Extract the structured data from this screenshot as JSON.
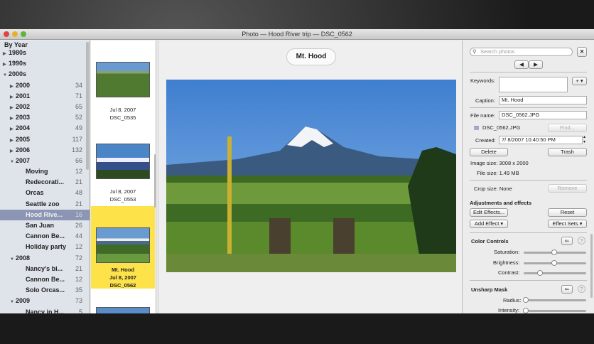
{
  "window": {
    "title": "Photo — Hood River trip — DSC_0562"
  },
  "sidebar": {
    "header": "By Year",
    "items": [
      {
        "label": "1980s",
        "count": "",
        "level": 0,
        "state": "collapsed"
      },
      {
        "label": "1990s",
        "count": "",
        "level": 0,
        "state": "collapsed"
      },
      {
        "label": "2000s",
        "count": "",
        "level": 0,
        "state": "expanded"
      },
      {
        "label": "2000",
        "count": "34",
        "level": 1,
        "state": "collapsed"
      },
      {
        "label": "2001",
        "count": "71",
        "level": 1,
        "state": "collapsed"
      },
      {
        "label": "2002",
        "count": "65",
        "level": 1,
        "state": "collapsed"
      },
      {
        "label": "2003",
        "count": "52",
        "level": 1,
        "state": "collapsed"
      },
      {
        "label": "2004",
        "count": "49",
        "level": 1,
        "state": "collapsed"
      },
      {
        "label": "2005",
        "count": "117",
        "level": 1,
        "state": "collapsed"
      },
      {
        "label": "2006",
        "count": "132",
        "level": 1,
        "state": "collapsed"
      },
      {
        "label": "2007",
        "count": "66",
        "level": 1,
        "state": "expanded"
      },
      {
        "label": "Moving",
        "count": "12",
        "level": 2
      },
      {
        "label": "Redecorati...",
        "count": "21",
        "level": 2
      },
      {
        "label": "Orcas",
        "count": "48",
        "level": 2
      },
      {
        "label": "Seattle zoo",
        "count": "21",
        "level": 2
      },
      {
        "label": "Hood Rive...",
        "count": "16",
        "level": 2,
        "selected": true
      },
      {
        "label": "San Juan",
        "count": "26",
        "level": 2
      },
      {
        "label": "Cannon Be...",
        "count": "44",
        "level": 2
      },
      {
        "label": "Holiday party",
        "count": "12",
        "level": 2
      },
      {
        "label": "2008",
        "count": "72",
        "level": 1,
        "state": "expanded"
      },
      {
        "label": "Nancy's bi...",
        "count": "21",
        "level": 2
      },
      {
        "label": "Cannon Be...",
        "count": "12",
        "level": 2
      },
      {
        "label": "Solo Orcas...",
        "count": "35",
        "level": 2
      },
      {
        "label": "2009",
        "count": "73",
        "level": 1,
        "state": "expanded"
      },
      {
        "label": "Nancy in H...",
        "count": "5",
        "level": 2
      }
    ]
  },
  "thumbnails": [
    {
      "caption": "",
      "date": "Jul 8, 2007",
      "name": "DSC_0535"
    },
    {
      "caption": "",
      "date": "Jul 8, 2007",
      "name": "DSC_0553"
    },
    {
      "caption": "Mt. Hood",
      "date": "Jul 8, 2007",
      "name": "DSC_0562",
      "selected": true
    }
  ],
  "main": {
    "caption": "Mt. Hood"
  },
  "inspector": {
    "search_placeholder": "Search photos",
    "keywords_label": "Keywords:",
    "keywords_value": "",
    "keywords_add": "+ ▾",
    "caption_label": "Caption:",
    "caption_value": "Mt. Hood",
    "filename_label": "File name:",
    "filename_value": "DSC_0562.JPG",
    "file_ref": "DSC_0562.JPG",
    "find": "Find...",
    "created_label": "Created:",
    "created_value": "7/  8/2007  10:40:50  PM",
    "delete": "Delete",
    "trash": "Trash",
    "image_size": "Image size: 3008 x 2000",
    "file_size": "File size:  1.49 MB",
    "crop_size": "Crop size:  None",
    "remove": "Remove",
    "adjustments_title": "Adjustments and effects",
    "edit_effects": "Edit Effects...",
    "reset": "Reset",
    "add_effect": "Add Effect  ▾",
    "effect_sets": "Effect Sets  ▾",
    "color_controls": "Color Controls",
    "saturation_label": "Saturation:",
    "saturation": 0.5,
    "brightness_label": "Brightness:",
    "brightness": 0.5,
    "contrast_label": "Contrast:",
    "contrast": 0.25,
    "unsharp_mask": "Unsharp Mask",
    "radius_label": "Radius:",
    "radius": 0.0,
    "intensity_label": "Intensity:",
    "intensity": 0.0
  }
}
